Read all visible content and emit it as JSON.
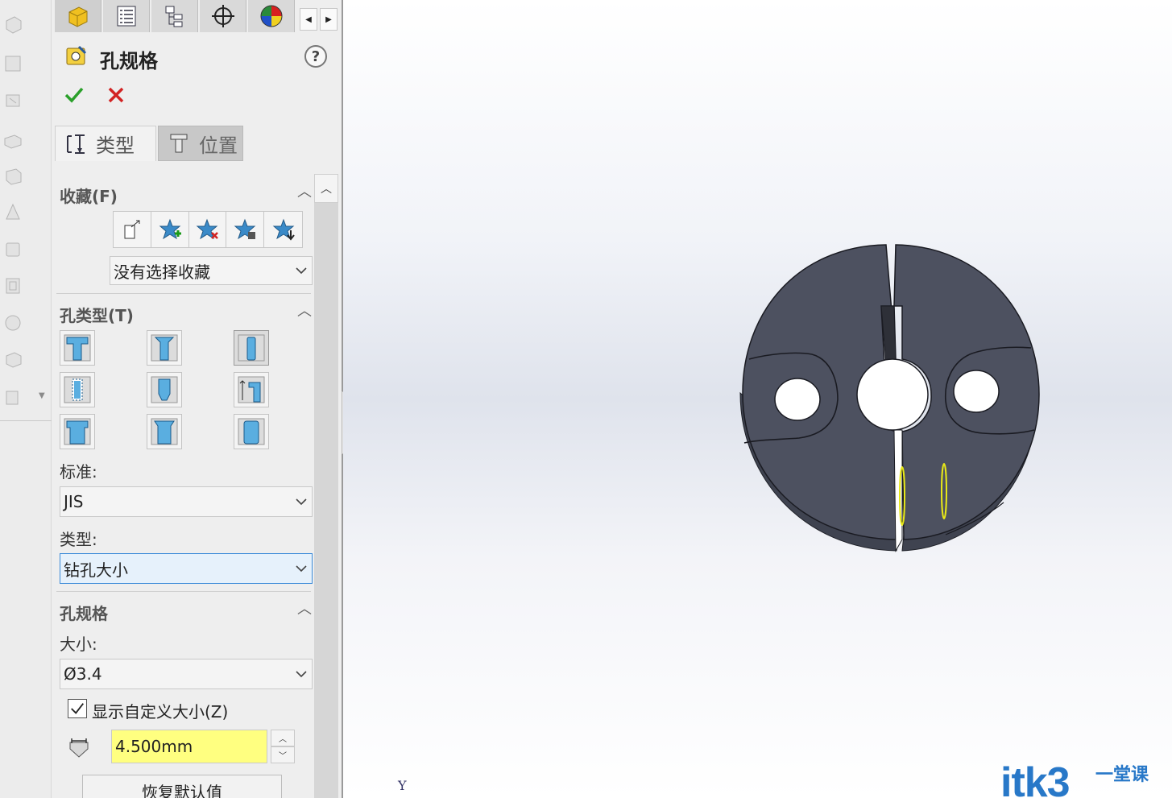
{
  "panel": {
    "title": "孔规格",
    "help": "?",
    "tabs": {
      "type_label": "类型",
      "position_label": "位置"
    },
    "favorites": {
      "header": "收藏(F)",
      "selected": "没有选择收藏"
    },
    "hole_type": {
      "header": "孔类型(T)",
      "standard_label": "标准:",
      "standard_value": "JIS",
      "type_label": "类型:",
      "type_value": "钻孔大小"
    },
    "hole_spec": {
      "header": "孔规格",
      "size_label": "大小:",
      "size_value": "Ø3.4",
      "custom_size_label": "显示自定义大小(Z)",
      "custom_size_checked": true,
      "diameter_value": "4.500mm",
      "restore_label": "恢复默认值"
    }
  },
  "viewport": {
    "axis_label": "Y",
    "watermark": "itk3",
    "watermark_suffix": "一堂课",
    "part_color": "#4d5160",
    "highlight_color": "#e8e818"
  }
}
